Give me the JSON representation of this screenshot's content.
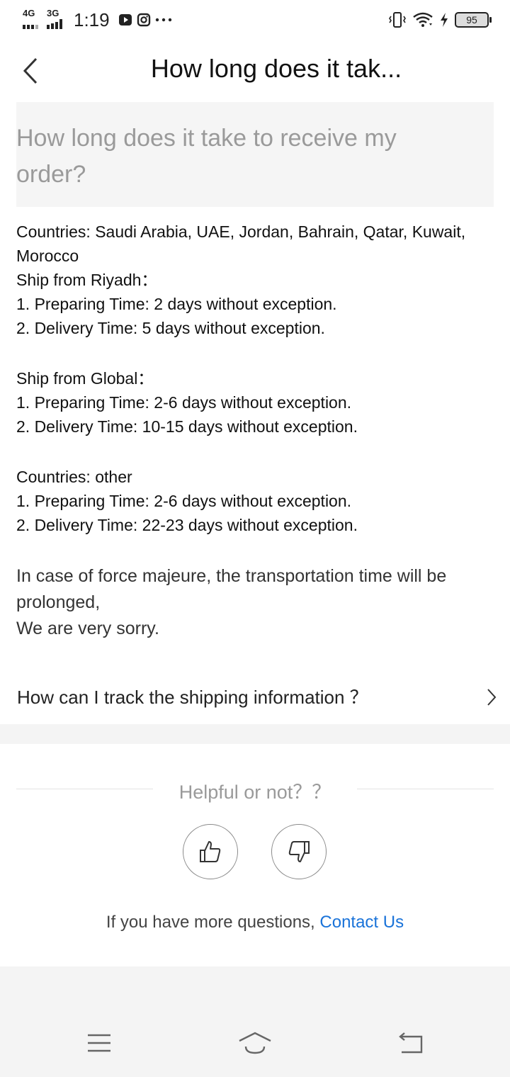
{
  "status_bar": {
    "net1": "4G",
    "net2": "3G",
    "time": "1:19",
    "battery": "95"
  },
  "header": {
    "title": "How long does it tak..."
  },
  "question": {
    "text": "How long does it take to receive my order?"
  },
  "answer": {
    "lines": [
      "Countries: Saudi Arabia, UAE, Jordan, Bahrain, Qatar, Kuwait, Morocco",
      "Ship from Riyadh：",
      "1. Preparing Time: 2 days without exception.",
      "2. Delivery Time: 5 days without exception.",
      "Ship from Global：",
      "1. Preparing Time: 2-6 days without exception.",
      "2. Delivery Time: 10-15 days without exception.",
      "Countries: other",
      "1. Preparing Time: 2-6 days without exception.",
      "2. Delivery Time: 22-23 days without exception."
    ],
    "note_lines": [
      "In case of force majeure, the transportation time will be prolonged,",
      "We are very sorry."
    ]
  },
  "related": {
    "label": "How can I track the shipping information ？"
  },
  "feedback": {
    "title": "Helpful or not？？",
    "contact_prefix": "If you have more questions, ",
    "contact_link": "Contact Us",
    "link_color": "#1a73d9"
  },
  "icons": {
    "back": "chevron-left-icon",
    "related": "chevron-right-icon",
    "like": "thumbs-up-icon",
    "dislike": "thumbs-down-icon",
    "menu": "menu-icon",
    "home": "home-icon",
    "back_nav": "back-arrow-icon"
  }
}
